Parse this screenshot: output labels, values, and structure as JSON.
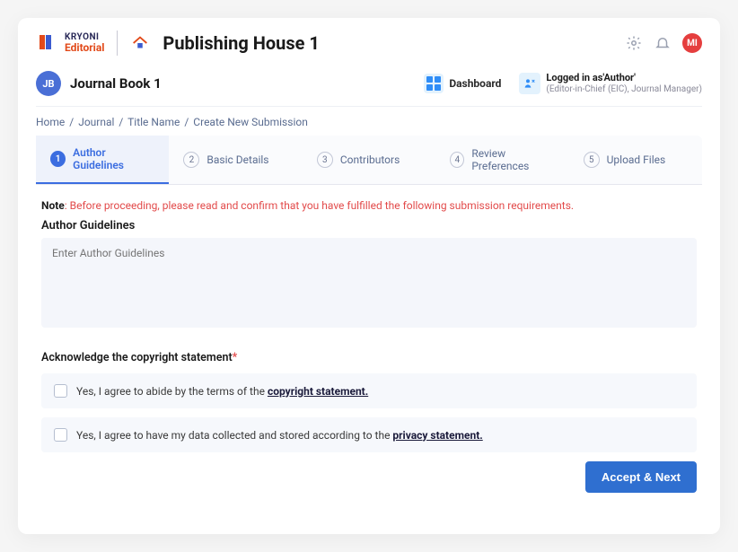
{
  "brand": {
    "line1": "KRYONI",
    "line2": "Editorial"
  },
  "header": {
    "publishing_house": "Publishing House 1",
    "avatar_initials": "MI"
  },
  "subheader": {
    "journal_badge": "JB",
    "journal_title": "Journal Book 1",
    "dashboard_label": "Dashboard",
    "login_line1": "Logged in as'Author'",
    "login_line2": "(Editor-in-Chief (EIC), Journal Manager)"
  },
  "breadcrumb": {
    "items": [
      "Home",
      "Journal",
      "Title Name",
      "Create New Submission"
    ]
  },
  "tabs": [
    {
      "num": "1",
      "label": "Author Guidelines",
      "active": true
    },
    {
      "num": "2",
      "label": "Basic Details",
      "active": false
    },
    {
      "num": "3",
      "label": "Contributors",
      "active": false
    },
    {
      "num": "4",
      "label": "Review Preferences",
      "active": false
    },
    {
      "num": "5",
      "label": "Upload Files",
      "active": false
    }
  ],
  "note": {
    "label": "Note",
    "body": ": Before proceeding, please read and confirm that you have fulfilled the following submission requirements."
  },
  "guidelines": {
    "section_label": "Author Guidelines",
    "placeholder": "Enter Author Guidelines"
  },
  "ack": {
    "label": "Acknowledge the copyright statement",
    "required_marker": "*",
    "row1_prefix": "Yes, I agree to abide by the terms of the ",
    "row1_link": "copyright statement.",
    "row2_prefix": "Yes, I agree to have my data collected and stored according to the ",
    "row2_link": "privacy statement."
  },
  "buttons": {
    "accept_next": "Accept & Next"
  }
}
